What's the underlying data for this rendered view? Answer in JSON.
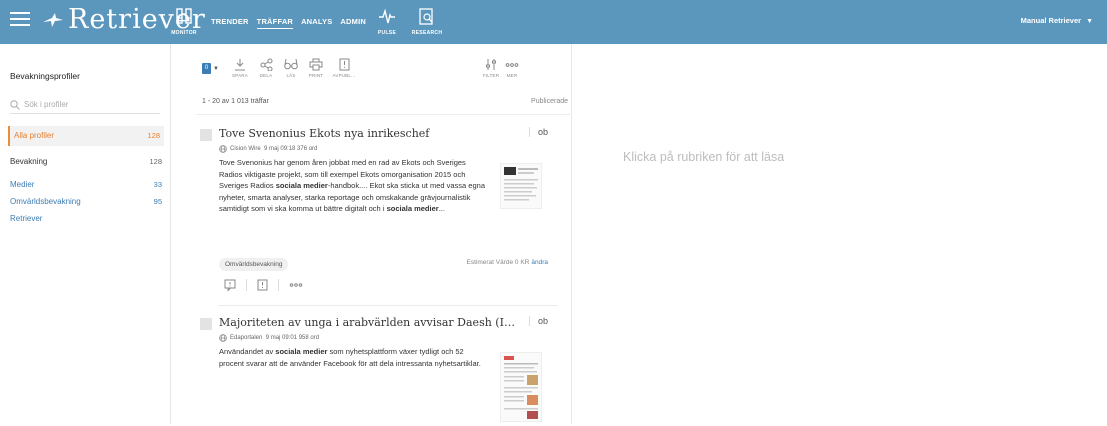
{
  "header": {
    "logo": "Retriever",
    "monitor_label": "MONITOR",
    "nav": [
      "TRENDER",
      "TRÄFFAR",
      "ANALYS",
      "ADMIN"
    ],
    "active_nav": "TRÄFFAR",
    "pulse_label": "PULSE",
    "research_label": "RESEARCH",
    "user": "Manual Retriever",
    "bg_color": "#5b97bd"
  },
  "sidebar": {
    "title": "Bevakningsprofiler",
    "search_placeholder": "Sök i profiler",
    "items": [
      {
        "label": "Alla profiler",
        "count": "128"
      },
      {
        "label": "Bevakning",
        "count": "128"
      },
      {
        "label": "Medier",
        "count": "33"
      },
      {
        "label": "Omvärldsbevakning",
        "count": "95"
      },
      {
        "label": "Retriever",
        "count": ""
      }
    ],
    "accent": "#e87f2c"
  },
  "toolbar": {
    "selected_count": "0",
    "buttons": [
      "SPARA",
      "DELA",
      "LÄS",
      "PRINT",
      "AVPUBL..."
    ],
    "right_buttons": [
      "FILTER",
      "MER"
    ]
  },
  "list": {
    "hits": "1 - 20 av 1 013 träffar",
    "sort": "Publicerade",
    "articles": [
      {
        "title": "Tove Svenonius Ekots nya inrikeschef",
        "badge": "ob",
        "source": "Cision Wire",
        "meta": "9 maj 09:18  376 ord",
        "body_1": "Tove Svenonius har genom åren jobbat med en rad av Ekots och Sveriges Radios viktigaste projekt, som till exempel Ekots omorganisation 2015 och Sveriges Radios ",
        "body_b1": "sociala medier",
        "body_2": "-handbok.... Ekot ska sticka ut med vassa egna nyheter, smarta analyser, starka reportage och omskakande grävjournalistik samtidigt som vi ska komma ut bättre digitalt och i ",
        "body_b2": "sociala medier",
        "body_3": "...",
        "tag": "Omvärldsbevakning",
        "est_label": "Estimerat Värde 0 KR",
        "est_link": "ändra"
      },
      {
        "title": "Majoriteten av unga i arabvärlden avvisar Daesh (IS) och tr...",
        "badge": "ob",
        "source": "Edaportalen",
        "meta": "9 maj 09:01  958 ord",
        "body_1": "Användandet av ",
        "body_b1": "sociala medier",
        "body_2": " som nyhetsplattform växer tydligt och 52 procent svarar att de använder Facebook för att dela intressanta nyhetsartiklar."
      }
    ]
  },
  "reader": {
    "hint": "Klicka på rubriken för att läsa"
  }
}
